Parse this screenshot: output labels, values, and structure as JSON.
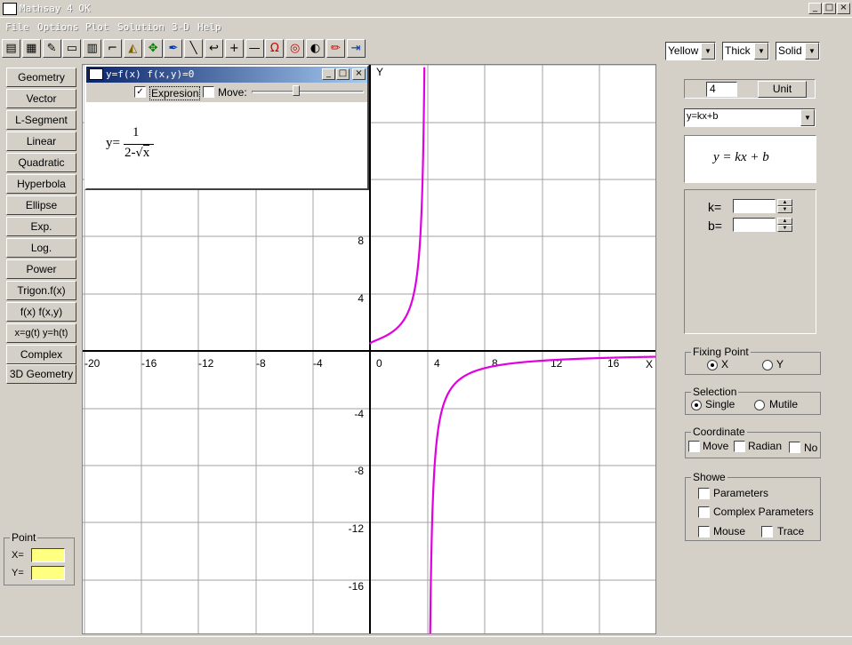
{
  "window": {
    "title": "Mathsay 4 OK"
  },
  "menu": [
    "File",
    "Options",
    "Plot",
    "Solution",
    "3-D",
    "Help"
  ],
  "toolbar": {
    "icons": [
      "print-icon",
      "save-icon",
      "draw-icon",
      "eraser-icon",
      "chart-icon",
      "corner-icon",
      "fill-icon",
      "move-icon",
      "pen-icon",
      "line-icon",
      "back-arrow-icon",
      "plus-icon",
      "minus-icon",
      "magnet-icon",
      "target-icon",
      "circle-icon",
      "pencil-icon",
      "exit-icon"
    ],
    "color": "Yellow",
    "thickness": "Thick",
    "style": "Solid"
  },
  "left_buttons": [
    "Geometry",
    "Vector",
    "L-Segment",
    "Linear",
    "Quadratic",
    "Hyperbola",
    "Ellipse",
    "Exp.",
    "Log.",
    "Power",
    "Trigon.f(x)",
    "f(x)  f(x,y)",
    "x=g(t) y=h(t)",
    "Complex",
    "3D Geometry"
  ],
  "point": {
    "title": "Point",
    "x_label": "X=",
    "y_label": "Y=",
    "x": "",
    "y": ""
  },
  "graph": {
    "x_axis_label": "X",
    "y_axis_label": "Y",
    "x_ticks": [
      "-20",
      "-16",
      "-12",
      "-8",
      "-4",
      "0",
      "4",
      "8",
      "12",
      "16"
    ],
    "y_ticks": [
      "8",
      "4",
      "-4",
      "-8",
      "-12",
      "-16"
    ],
    "curve_color": "#e000e0"
  },
  "function_window": {
    "title": "y=f(x)  f(x,y)=0",
    "expression_label": "Expresion",
    "expression_checked": true,
    "move_label": "Move:",
    "move_checked": false,
    "eq_prefix": "y=",
    "eq_num": "1",
    "eq_den_a": "2-",
    "eq_den_b": "x"
  },
  "right_panel": {
    "unit_value": "4",
    "unit_label": "Unit",
    "function_select": "y=kx+b",
    "formula": "y = kx + b",
    "k_label": "k=",
    "b_label": "b=",
    "k_value": "",
    "b_value": "",
    "fixing_point": {
      "title": "Fixing Point",
      "x": "X",
      "y": "Y",
      "selected": "X"
    },
    "selection": {
      "title": "Selection",
      "single": "Single",
      "multiple": "Mutile",
      "selected": "Single"
    },
    "coordinate": {
      "title": "Coordinate",
      "move": "Move",
      "radian": "Radian",
      "no": "No"
    },
    "showe": {
      "title": "Showe",
      "parameters": "Parameters",
      "complex": "Complex Parameters",
      "mouse": "Mouse",
      "trace": "Trace"
    }
  }
}
